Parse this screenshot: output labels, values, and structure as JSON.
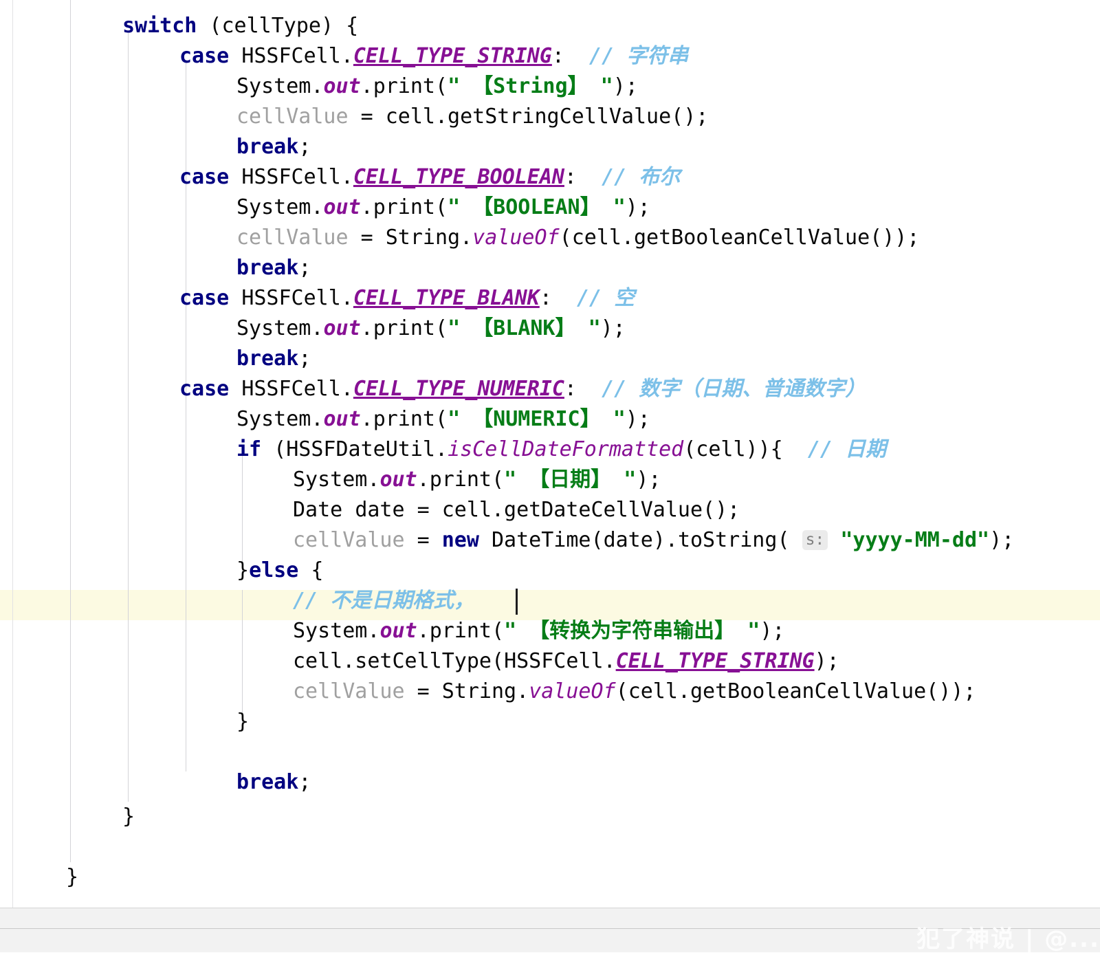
{
  "editor": {
    "language": "java",
    "font_size_px": 30,
    "line_height_px": 44,
    "background": "#ffffff",
    "caret_line_background": "#fcfae2",
    "colors": {
      "keyword": "#000080",
      "static_field": "#871094",
      "string": "#067d17",
      "comment": "#8c8c8c",
      "comment_cjk": "#7cc0e8",
      "local_variable": "#a0a0a0",
      "default_text": "#080808",
      "indent_guide": "#d3d3d7",
      "inlay_hint_background": "#ebebeb",
      "inlay_hint_text": "#808080"
    },
    "caret": {
      "line_index": 19,
      "visible": true
    },
    "lines": [
      {
        "indent": 0,
        "text": "switch (cellType) {"
      },
      {
        "indent": 1,
        "text": "case HSSFCell.CELL_TYPE_STRING: // 字符串"
      },
      {
        "indent": 2,
        "text": "System.out.print(\" 【String】 \");"
      },
      {
        "indent": 2,
        "text": "cellValue = cell.getStringCellValue();"
      },
      {
        "indent": 2,
        "text": "break;"
      },
      {
        "indent": 1,
        "text": "case HSSFCell.CELL_TYPE_BOOLEAN: // 布尔"
      },
      {
        "indent": 2,
        "text": "System.out.print(\" 【BOOLEAN】 \");"
      },
      {
        "indent": 2,
        "text": "cellValue = String.valueOf(cell.getBooleanCellValue());"
      },
      {
        "indent": 2,
        "text": "break;"
      },
      {
        "indent": 1,
        "text": "case HSSFCell.CELL_TYPE_BLANK: // 空"
      },
      {
        "indent": 2,
        "text": "System.out.print(\" 【BLANK】 \");"
      },
      {
        "indent": 2,
        "text": "break;"
      },
      {
        "indent": 1,
        "text": "case HSSFCell.CELL_TYPE_NUMERIC: // 数字（日期、普通数字）"
      },
      {
        "indent": 2,
        "text": "System.out.print(\" 【NUMERIC】 \");"
      },
      {
        "indent": 2,
        "text": "if (HSSFDateUtil.isCellDateFormatted(cell)){ // 日期"
      },
      {
        "indent": 3,
        "text": "System.out.print(\" 【日期】 \");"
      },
      {
        "indent": 3,
        "text": "Date date = cell.getDateCellValue();"
      },
      {
        "indent": 3,
        "text": "cellValue = new DateTime(date).toString( s: \"yyyy-MM-dd\");"
      },
      {
        "indent": 2,
        "text": "}else {"
      },
      {
        "indent": 3,
        "text": "// 不是日期格式，"
      },
      {
        "indent": 3,
        "text": "System.out.print(\" 【转换为字符串输出】 \");"
      },
      {
        "indent": 3,
        "text": "cell.setCellType(HSSFCell.CELL_TYPE_STRING);"
      },
      {
        "indent": 3,
        "text": "cellValue = String.valueOf(cell.getBooleanCellValue());"
      },
      {
        "indent": 2,
        "text": "}"
      },
      {
        "indent": 2,
        "text": ""
      },
      {
        "indent": 2,
        "text": "break;"
      },
      {
        "indent": 0,
        "text": "}"
      },
      {
        "indent": 0,
        "text": ""
      },
      {
        "indent": -1,
        "text": "}"
      }
    ],
    "tokens": {
      "kw_switch": "switch",
      "kw_case": "case",
      "kw_break": "break",
      "kw_if": "if",
      "kw_else": "else",
      "kw_new": "new",
      "class_hssfcell": "HSSFCell",
      "class_hssfdateutil": "HSSFDateUtil",
      "class_system": "System",
      "class_string": "String",
      "class_date": "Date",
      "class_datetime": "DateTime",
      "field_cell_type_string": "CELL_TYPE_STRING",
      "field_cell_type_boolean": "CELL_TYPE_BOOLEAN",
      "field_cell_type_blank": "CELL_TYPE_BLANK",
      "field_cell_type_numeric": "CELL_TYPE_NUMERIC",
      "field_out": "out",
      "method_print": "print",
      "method_valueof": "valueOf",
      "method_isCellDateFormatted": "isCellDateFormatted",
      "method_toString": "toString",
      "var_cellType": "cellType",
      "var_cellValue": "cellValue",
      "var_cell": "cell",
      "var_date": "date",
      "inlay_hint_s": "s:",
      "str_date_format": "\"yyyy-MM-dd\"",
      "str_string_tag": "【String】",
      "str_boolean_tag": "【BOOLEAN】",
      "str_blank_tag": "【BLANK】",
      "str_numeric_tag": "【NUMERIC】",
      "str_date_tag": "【日期】",
      "str_convert_tag": "【转换为字符串输出】"
    },
    "comments": {
      "string_cn": "// 字符串",
      "boolean_cn": "// 布尔",
      "blank_cn": "// 空",
      "numeric_cn": "// 数字（日期、普通数字）",
      "date_cn": "// 日期",
      "not_date_format_cn": "// 不是日期格式，"
    }
  },
  "bottom_panel": {
    "watermark": "犯了神说 | @..."
  }
}
